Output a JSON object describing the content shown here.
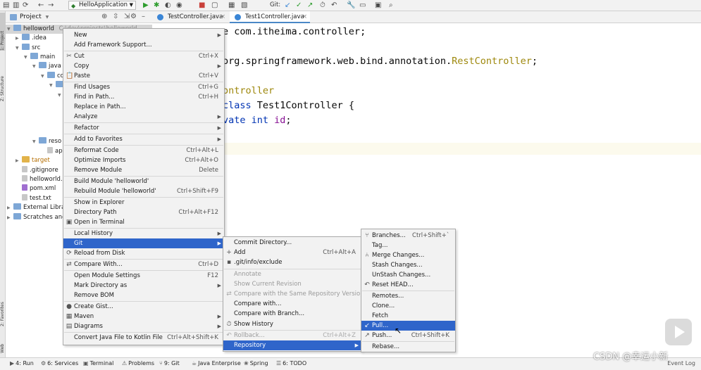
{
  "toolbar": {
    "run_config": "HelloApplication",
    "git_label": "Git:"
  },
  "left_strip": {
    "project_tab": "1: Project",
    "structure_tab": "Z: Structure",
    "favorites_tab": "2: Favorites",
    "web_tab": "Web"
  },
  "project_panel": {
    "title": "Project",
    "tree": [
      {
        "label": "helloworld",
        "hint": "C:\\dev\\projects\\helloworld",
        "indent": 0,
        "icon": "folder",
        "expanded": true,
        "selected": true
      },
      {
        "label": ".idea",
        "indent": 1,
        "icon": "folder",
        "expanded": false
      },
      {
        "label": "src",
        "indent": 1,
        "icon": "folder",
        "expanded": true
      },
      {
        "label": "main",
        "indent": 2,
        "icon": "folder",
        "expanded": true
      },
      {
        "label": "java",
        "indent": 3,
        "icon": "folder",
        "expanded": true
      },
      {
        "label": "co",
        "indent": 4,
        "icon": "folder",
        "expanded": true
      },
      {
        "label": "",
        "indent": 5,
        "icon": "folder",
        "expanded": true
      },
      {
        "label": "",
        "indent": 6,
        "icon": "folder",
        "expanded": true
      },
      {
        "label": "reso",
        "indent": 3,
        "icon": "folder",
        "expanded": true
      },
      {
        "label": "ap",
        "indent": 4,
        "icon": "file"
      },
      {
        "label": "target",
        "indent": 1,
        "icon": "folder-yellow",
        "expanded": false,
        "style": "orange"
      },
      {
        "label": ".gitignore",
        "indent": 1,
        "icon": "file"
      },
      {
        "label": "helloworld.",
        "indent": 1,
        "icon": "file"
      },
      {
        "label": "pom.xml",
        "indent": 1,
        "icon": "file-m"
      },
      {
        "label": "test.txt",
        "indent": 1,
        "icon": "file"
      },
      {
        "label": "External Librar",
        "indent": 0,
        "icon": "folder",
        "expanded": false
      },
      {
        "label": "Scratches and",
        "indent": 0,
        "icon": "folder",
        "expanded": false
      }
    ]
  },
  "editor_tabs": [
    {
      "label": "TestController.java",
      "active": false
    },
    {
      "label": "Test1Controller.java",
      "active": true
    }
  ],
  "code": [
    [
      {
        "t": "e com.itheima.controller;",
        "c": ""
      }
    ],
    [
      {
        "t": "",
        "c": ""
      }
    ],
    [
      {
        "t": "org.springframework.web.bind.annotation.",
        "c": ""
      },
      {
        "t": "RestController",
        "c": "ann"
      },
      {
        "t": ";",
        "c": ""
      }
    ],
    [
      {
        "t": "",
        "c": ""
      }
    ],
    [
      {
        "t": "ontroller",
        "c": "ann"
      }
    ],
    [
      {
        "t": "class ",
        "c": "kw"
      },
      {
        "t": "Test1Controller {",
        "c": ""
      }
    ],
    [
      {
        "t": "vate ",
        "c": "kw"
      },
      {
        "t": "int ",
        "c": "kw"
      },
      {
        "t": "id",
        "c": "ident"
      },
      {
        "t": ";",
        "c": ""
      }
    ]
  ],
  "context_menu": {
    "items": [
      {
        "label": "New",
        "arrow": true
      },
      {
        "label": "Add Framework Support..."
      },
      {
        "sep": true
      },
      {
        "label": "Cut",
        "icon": "✂",
        "shortcut": "Ctrl+X"
      },
      {
        "label": "Copy",
        "arrow": true
      },
      {
        "label": "Paste",
        "icon": "📋",
        "shortcut": "Ctrl+V"
      },
      {
        "sep": true
      },
      {
        "label": "Find Usages",
        "shortcut": "Ctrl+G"
      },
      {
        "label": "Find in Path...",
        "shortcut": "Ctrl+H"
      },
      {
        "label": "Replace in Path..."
      },
      {
        "label": "Analyze",
        "arrow": true
      },
      {
        "sep": true
      },
      {
        "label": "Refactor",
        "arrow": true
      },
      {
        "sep": true
      },
      {
        "label": "Add to Favorites",
        "arrow": true
      },
      {
        "sep": true
      },
      {
        "label": "Reformat Code",
        "shortcut": "Ctrl+Alt+L"
      },
      {
        "label": "Optimize Imports",
        "shortcut": "Ctrl+Alt+O"
      },
      {
        "label": "Remove Module",
        "shortcut": "Delete"
      },
      {
        "sep": true
      },
      {
        "label": "Build Module 'helloworld'"
      },
      {
        "label": "Rebuild Module 'helloworld'",
        "shortcut": "Ctrl+Shift+F9"
      },
      {
        "sep": true
      },
      {
        "label": "Show in Explorer"
      },
      {
        "label": "Directory Path",
        "shortcut": "Ctrl+Alt+F12"
      },
      {
        "label": "Open in Terminal",
        "icon": "▣"
      },
      {
        "sep": true
      },
      {
        "label": "Local History",
        "arrow": true
      },
      {
        "label": "Git",
        "arrow": true,
        "highlight": true
      },
      {
        "label": "Reload from Disk",
        "icon": "⟳"
      },
      {
        "sep": true
      },
      {
        "label": "Compare With...",
        "icon": "⇄",
        "shortcut": "Ctrl+D"
      },
      {
        "sep": true
      },
      {
        "label": "Open Module Settings",
        "shortcut": "F12"
      },
      {
        "label": "Mark Directory as",
        "arrow": true
      },
      {
        "label": "Remove BOM"
      },
      {
        "sep": true
      },
      {
        "label": "Create Gist...",
        "icon": "●"
      },
      {
        "label": "Maven",
        "icon": "▦",
        "arrow": true
      },
      {
        "label": "Diagrams",
        "icon": "▤",
        "arrow": true
      },
      {
        "sep": true
      },
      {
        "label": "Convert Java File to Kotlin File",
        "shortcut": "Ctrl+Alt+Shift+K"
      }
    ]
  },
  "git_menu": {
    "items": [
      {
        "label": "Commit Directory..."
      },
      {
        "label": "Add",
        "icon": "+",
        "shortcut": "Ctrl+Alt+A"
      },
      {
        "label": ".git/info/exclude",
        "icon": "▪"
      },
      {
        "sep": true
      },
      {
        "label": "Annotate",
        "disabled": true
      },
      {
        "label": "Show Current Revision",
        "disabled": true
      },
      {
        "label": "Compare with the Same Repository Version",
        "icon": "⇄",
        "disabled": true
      },
      {
        "label": "Compare with..."
      },
      {
        "label": "Compare with Branch..."
      },
      {
        "label": "Show History",
        "icon": "⏱"
      },
      {
        "sep": true
      },
      {
        "label": "Rollback...",
        "icon": "↶",
        "shortcut": "Ctrl+Alt+Z",
        "disabled": true
      },
      {
        "label": "Repository",
        "arrow": true,
        "highlight": true
      }
    ]
  },
  "repo_menu": {
    "items": [
      {
        "label": "Branches...",
        "icon": "⑂",
        "shortcut": "Ctrl+Shift+`"
      },
      {
        "label": "Tag..."
      },
      {
        "label": "Merge Changes...",
        "icon": "⑃"
      },
      {
        "label": "Stash Changes..."
      },
      {
        "label": "UnStash Changes..."
      },
      {
        "label": "Reset HEAD...",
        "icon": "↶"
      },
      {
        "sep": true
      },
      {
        "label": "Remotes..."
      },
      {
        "label": "Clone..."
      },
      {
        "label": "Fetch"
      },
      {
        "label": "Pull...",
        "icon": "↙",
        "highlight": true
      },
      {
        "label": "Push...",
        "icon": "↗",
        "shortcut": "Ctrl+Shift+K"
      },
      {
        "sep": true
      },
      {
        "label": "Rebase..."
      }
    ]
  },
  "statusbar": {
    "items": [
      {
        "label": "4: Run",
        "icon": "▶"
      },
      {
        "label": "6: Services",
        "icon": "⚙"
      },
      {
        "label": "Terminal",
        "icon": "▣"
      },
      {
        "label": "Problems",
        "icon": "⚠"
      },
      {
        "label": "9: Git",
        "icon": "⑂"
      },
      {
        "label": "Java Enterprise",
        "icon": "☕"
      },
      {
        "label": "Spring",
        "icon": "❀"
      },
      {
        "label": "6: TODO",
        "icon": "☰"
      }
    ],
    "right": "Event Log"
  },
  "watermark": "CSDN @幸运小新"
}
